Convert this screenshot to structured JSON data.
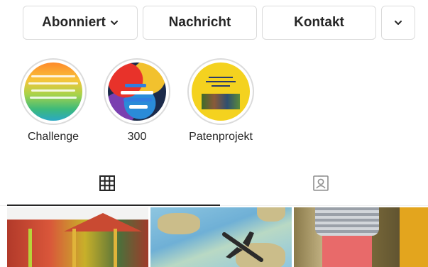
{
  "actions": {
    "subscribed_label": "Abonniert",
    "message_label": "Nachricht",
    "contact_label": "Kontakt",
    "subscribed_icon": "chevron-down-icon",
    "more_icon": "chevron-down-icon"
  },
  "highlights": [
    {
      "label": "Challenge"
    },
    {
      "label": "300"
    },
    {
      "label": "Patenprojekt"
    }
  ],
  "tabs": [
    {
      "icon": "grid-icon",
      "active": true
    },
    {
      "icon": "tagged-user-icon",
      "active": false
    }
  ],
  "colors": {
    "border": "#dbdbdb",
    "text": "#262626",
    "active_tab_underline": "#262626"
  }
}
